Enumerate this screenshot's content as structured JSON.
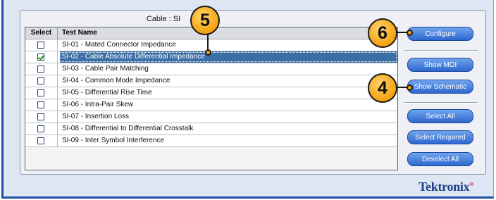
{
  "panel": {
    "title": "Cable : SI"
  },
  "table": {
    "headers": {
      "select": "Select",
      "test_name": "Test Name"
    },
    "rows": [
      {
        "name": "SI-01 - Mated Connector Impedance",
        "checked": false,
        "selected": false
      },
      {
        "name": "SI-02 - Cable Absolute Differential Impedance",
        "checked": true,
        "selected": true
      },
      {
        "name": "SI-03 - Cable Pair Matching",
        "checked": false,
        "selected": false
      },
      {
        "name": "SI-04 - Common Mode Impedance",
        "checked": false,
        "selected": false
      },
      {
        "name": "SI-05 - Differential Rise Time",
        "checked": false,
        "selected": false
      },
      {
        "name": "SI-06 - Intra-Pair Skew",
        "checked": false,
        "selected": false
      },
      {
        "name": "SI-07 - Insertion Loss",
        "checked": false,
        "selected": false
      },
      {
        "name": "SI-08 - Differential to Differential Crosstalk",
        "checked": false,
        "selected": false
      },
      {
        "name": "SI-09 - Inter Symbol Interference",
        "checked": false,
        "selected": false
      }
    ]
  },
  "buttons": {
    "configure": "Configure",
    "show_moi": "Show MOI",
    "show_schematic": "Show Schematic",
    "select_all": "Select All",
    "select_required": "Select Required",
    "deselect_all": "Deselect All"
  },
  "callouts": {
    "c5": "5",
    "c6": "6",
    "c4": "4"
  },
  "brand": {
    "name": "Tektronix",
    "mark": "®"
  },
  "colors": {
    "accent": "#3a6ea5",
    "button": "#2e67cf",
    "callout": "#f5a20f",
    "frame": "#1f4fa6"
  }
}
